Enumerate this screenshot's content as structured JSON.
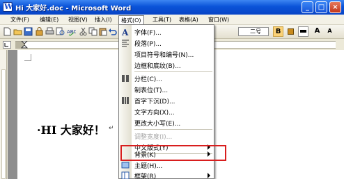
{
  "window": {
    "title": "Hi 大家好.doc - Microsoft Word",
    "app_icon": "W",
    "minimize": "_",
    "maximize": "□",
    "close": "×"
  },
  "menubar": {
    "items": [
      "文件(F)",
      "编辑(E)",
      "视图(V)",
      "插入(I)",
      "格式(O)",
      "工具(T)",
      "表格(A)",
      "窗口(W)"
    ]
  },
  "toolbar": {
    "font_size": "二号",
    "bold": "B",
    "grow_font": "A",
    "shrink_font": "A"
  },
  "document": {
    "text": "·HI 大家好！",
    "paragraph_mark": "↵"
  },
  "format_menu": {
    "items": [
      {
        "label": "字体(F)...",
        "enabled": true,
        "submenu": false
      },
      {
        "label": "段落(P)...",
        "enabled": true,
        "submenu": false
      },
      {
        "label": "项目符号和编号(N)...",
        "enabled": true,
        "submenu": false
      },
      {
        "label": "边框和底纹(B)...",
        "enabled": true,
        "submenu": false
      },
      {
        "label": "分栏(C)...",
        "enabled": true,
        "submenu": false
      },
      {
        "label": "制表位(T)...",
        "enabled": true,
        "submenu": false
      },
      {
        "label": "首字下沉(D)...",
        "enabled": true,
        "submenu": false
      },
      {
        "label": "文字方向(X)...",
        "enabled": true,
        "submenu": false
      },
      {
        "label": "更改大小写(E)...",
        "enabled": true,
        "submenu": false
      },
      {
        "label": "调整宽度(I)...",
        "enabled": false,
        "submenu": false
      },
      {
        "label": "中文版式(Y)",
        "enabled": true,
        "submenu": true
      },
      {
        "label": "背景(K)",
        "enabled": true,
        "submenu": true
      },
      {
        "label": "主题(H)...",
        "enabled": true,
        "submenu": false
      },
      {
        "label": "框架(R)",
        "enabled": true,
        "submenu": true
      }
    ]
  },
  "colors": {
    "titlebar": "#0a53d8",
    "highlight_box": "#d81e1e",
    "active_button": "#fbd277"
  }
}
